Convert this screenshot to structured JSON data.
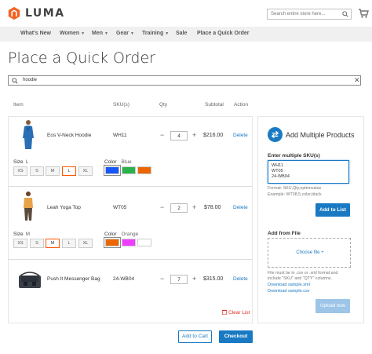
{
  "header": {
    "logo_text": "LUMA",
    "search_placeholder": "Search entire store here..."
  },
  "nav": [
    {
      "label": "What's New",
      "has_caret": false
    },
    {
      "label": "Women",
      "has_caret": true
    },
    {
      "label": "Men",
      "has_caret": true
    },
    {
      "label": "Gear",
      "has_caret": true
    },
    {
      "label": "Training",
      "has_caret": true
    },
    {
      "label": "Sale",
      "has_caret": false
    },
    {
      "label": "Place a Quick Order",
      "has_caret": false
    }
  ],
  "page_title": "Place a Quick Order",
  "product_search": {
    "value": "hoodie",
    "clear": "✕"
  },
  "columns": {
    "item": "Item",
    "sku": "SKU(s)",
    "qty": "Qty",
    "subtotal": "Subtotal",
    "action": "Action"
  },
  "items": [
    {
      "name": "Eos V-Neck Hoodie",
      "sku": "WH11",
      "qty": "4",
      "subtotal": "$216.00",
      "delete": "Delete",
      "size_label": "Size",
      "size_value": "L",
      "sizes": [
        "XS",
        "S",
        "M",
        "L",
        "XL"
      ],
      "color_label": "Color",
      "color_value": "Blue",
      "colors": [
        "#1857f7",
        "#2bb24c",
        "#eb6703"
      ]
    },
    {
      "name": "Leah Yoga Top",
      "sku": "WT05",
      "qty": "2",
      "subtotal": "$78.00",
      "delete": "Delete",
      "size_label": "Size",
      "size_value": "M",
      "sizes": [
        "XS",
        "S",
        "M",
        "L",
        "XL"
      ],
      "color_label": "Color",
      "color_value": "Orange",
      "colors": [
        "#eb6703",
        "#ef3dff",
        "#ffffff"
      ]
    },
    {
      "name": "Push It Messenger Bag",
      "sku": "24-WB04",
      "qty": "7",
      "subtotal": "$315.00",
      "delete": "Delete"
    }
  ],
  "clear_list": "Clear List",
  "side": {
    "title": "Add Multiple Products",
    "enter_skus_label": "Enter multiple SKU(s)",
    "skus_value": "WH11\nWT05\n24-WB04",
    "format_hint": "Format: SKU,Qty,optionvalue",
    "example_hint": "Example: WT08,5,color,black",
    "add_to_list": "Add to List",
    "add_from_file": "Add from File",
    "choose_file": "Choose file",
    "file_hint_1": "File must be in .csv or .xml format and",
    "file_hint_2": "include \"SKU\" and \"QTY\" columns.",
    "download_xml": "Download sample.xml",
    "download_csv": "Download sample.csv",
    "upload_now": "Upload now"
  },
  "footer": {
    "add_to_cart": "Add to Cart",
    "checkout": "Checkout"
  },
  "accent_color": "#1979c3",
  "selected_border_color": "#ff5501"
}
